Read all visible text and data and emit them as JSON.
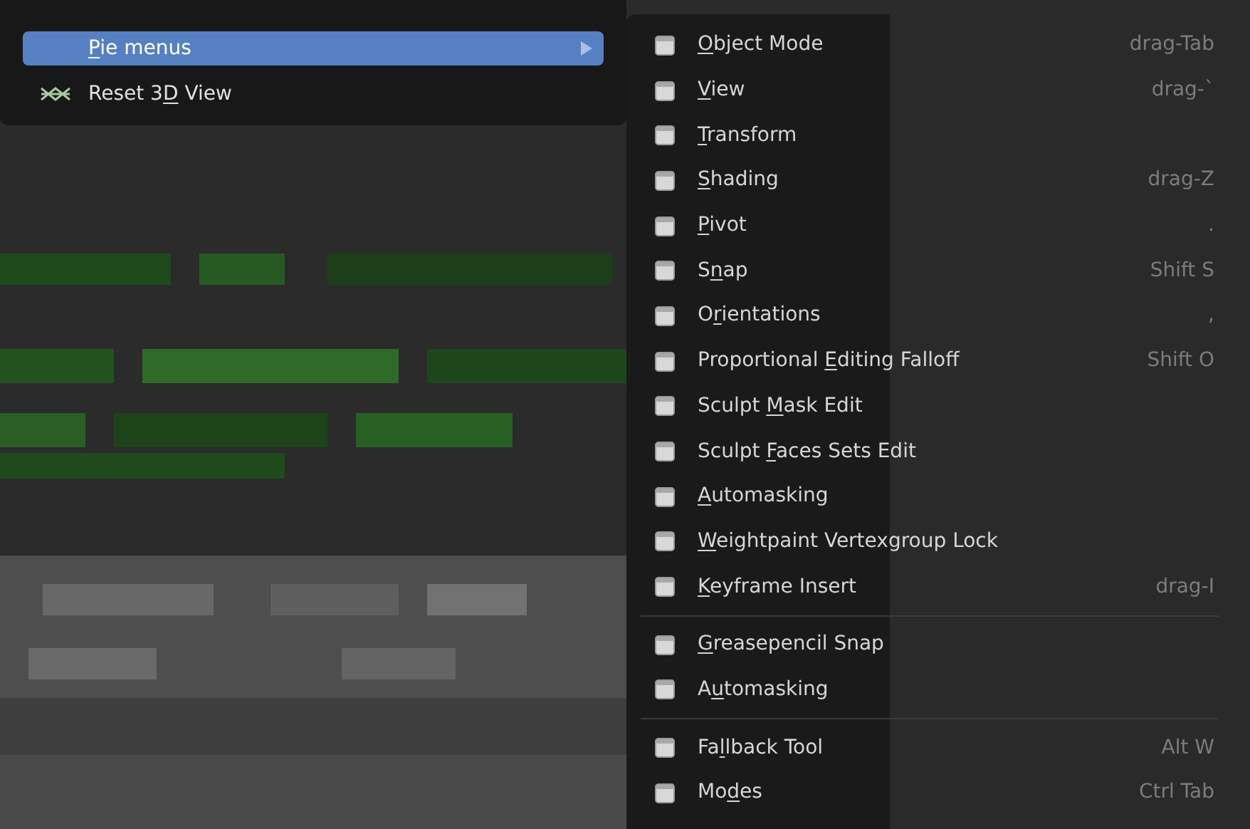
{
  "main_menu": {
    "items": [
      {
        "kind": "submenu",
        "key": "P",
        "after": "ie menus",
        "selected": true
      },
      {
        "kind": "action",
        "before": "Reset 3",
        "key": "D",
        "after": " View",
        "selected": false
      }
    ]
  },
  "submenu": {
    "sections": [
      [
        {
          "key": "O",
          "after": "bject Mode",
          "shortcut": "drag-Tab"
        },
        {
          "key": "V",
          "after": "iew",
          "shortcut": "drag-`"
        },
        {
          "key": "T",
          "after": "ransform"
        },
        {
          "key": "S",
          "after": "hading",
          "shortcut": "drag-Z"
        },
        {
          "key": "P",
          "after": "ivot",
          "shortcut": "."
        },
        {
          "before": "S",
          "key": "n",
          "after": "ap",
          "shortcut": "Shift S"
        },
        {
          "before": "O",
          "key": "r",
          "after": "ientations",
          "shortcut": ","
        },
        {
          "before": "Proportional ",
          "key": "E",
          "after": "diting Falloff",
          "shortcut": "Shift O"
        },
        {
          "before": "Sculpt ",
          "key": "M",
          "after": "ask Edit"
        },
        {
          "before": "Sculpt ",
          "key": "F",
          "after": "aces Sets Edit"
        },
        {
          "key": "A",
          "after": "utomasking"
        },
        {
          "key": "W",
          "after": "eightpaint Vertexgroup Lock"
        },
        {
          "key": "K",
          "after": "eyframe Insert",
          "shortcut": "drag-I"
        }
      ],
      [
        {
          "key": "G",
          "after": "reasepencil Snap"
        },
        {
          "before": "A",
          "key": "u",
          "after": "tomasking"
        }
      ],
      [
        {
          "before": "Fa",
          "key": "l",
          "after": "lback Tool",
          "shortcut": "Alt W"
        },
        {
          "before": "Mo",
          "key": "d",
          "after": "es",
          "shortcut": "Ctrl Tab"
        }
      ]
    ]
  }
}
